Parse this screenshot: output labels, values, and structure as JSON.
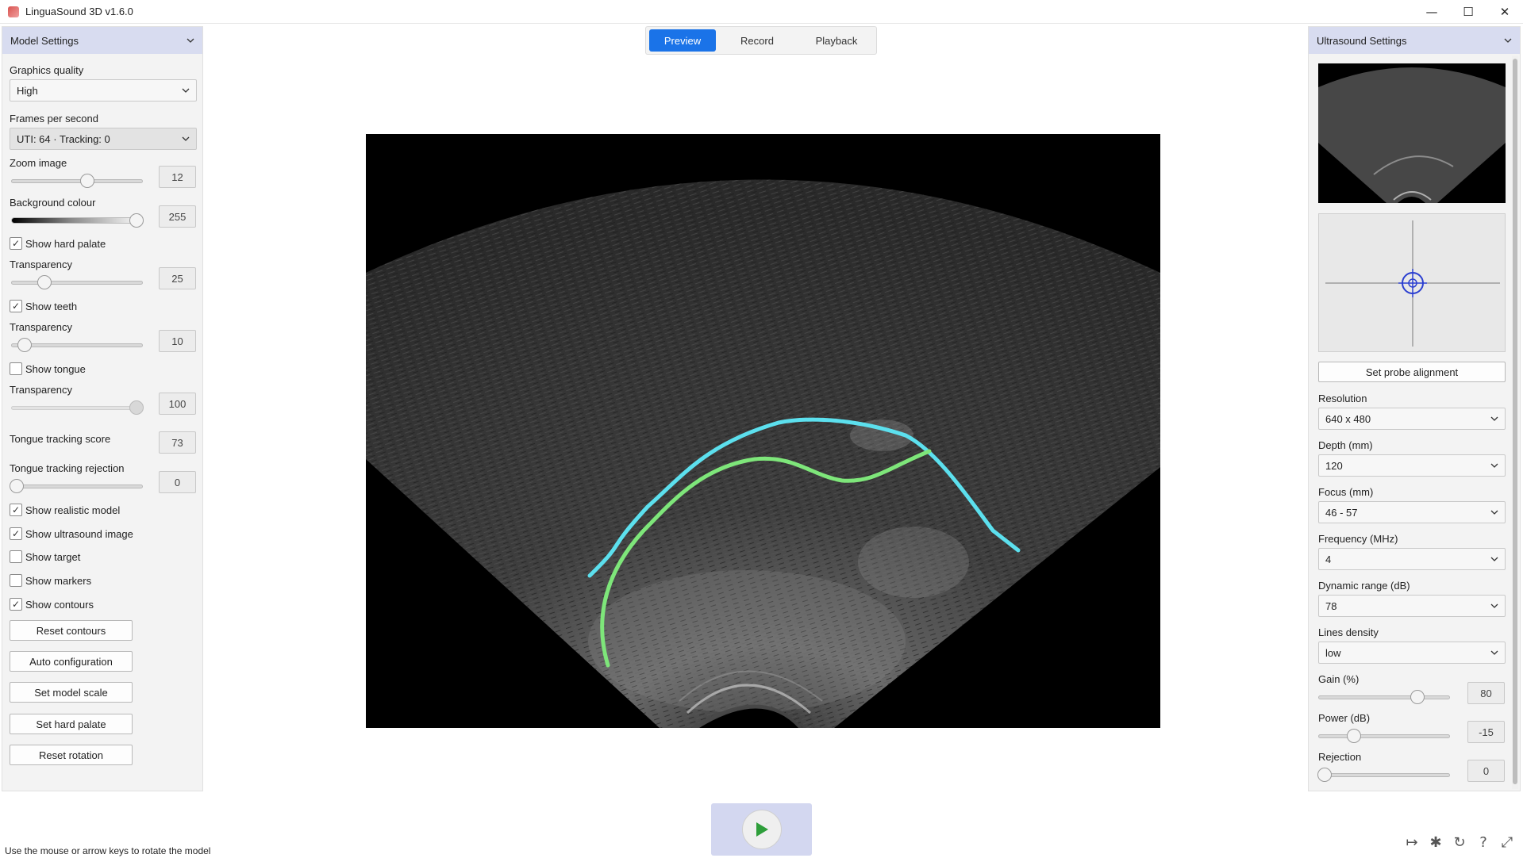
{
  "window": {
    "title": "LinguaSound 3D v1.6.0",
    "minimize_icon": "minimize-icon",
    "maximize_icon": "maximize-icon",
    "close_icon": "close-icon"
  },
  "tabs": [
    {
      "label": "Preview",
      "active": true
    },
    {
      "label": "Record",
      "active": false
    },
    {
      "label": "Playback",
      "active": false
    }
  ],
  "model_settings": {
    "title": "Model Settings",
    "graphics_quality": {
      "label": "Graphics quality",
      "value": "High"
    },
    "fps": {
      "label": "Frames per second",
      "value": "UTI: 64 · Tracking: 0"
    },
    "zoom": {
      "label": "Zoom image",
      "value": "12"
    },
    "background": {
      "label": "Background colour",
      "value": "255"
    },
    "hard_palate": {
      "label": "Show hard palate",
      "checked": true
    },
    "palate_transparency": {
      "label": "Transparency",
      "value": "25"
    },
    "teeth": {
      "label": "Show teeth",
      "checked": true
    },
    "teeth_transparency": {
      "label": "Transparency",
      "value": "10"
    },
    "tongue": {
      "label": "Show tongue",
      "checked": false
    },
    "tongue_transparency": {
      "label": "Transparency",
      "value": "100"
    },
    "tracking_score": {
      "label": "Tongue tracking score",
      "value": "73"
    },
    "tracking_rejection": {
      "label": "Tongue tracking rejection",
      "value": "0"
    },
    "realistic_model": {
      "label": "Show realistic model",
      "checked": true
    },
    "ultrasound_image": {
      "label": "Show ultrasound image",
      "checked": true
    },
    "target": {
      "label": "Show target",
      "checked": false
    },
    "markers": {
      "label": "Show markers",
      "checked": false
    },
    "contours": {
      "label": "Show contours",
      "checked": true
    },
    "buttons": {
      "reset_contours": "Reset contours",
      "auto_config": "Auto configuration",
      "set_model_scale": "Set model scale",
      "set_hard_palate": "Set hard palate",
      "reset_rotation": "Reset rotation"
    }
  },
  "ultrasound_settings": {
    "title": "Ultrasound Settings",
    "set_probe": "Set probe alignment",
    "resolution": {
      "label": "Resolution",
      "value": "640 x 480"
    },
    "depth": {
      "label": "Depth (mm)",
      "value": "120"
    },
    "focus": {
      "label": "Focus (mm)",
      "value": "46 - 57"
    },
    "frequency": {
      "label": "Frequency (MHz)",
      "value": "4"
    },
    "dynamic_range": {
      "label": "Dynamic range (dB)",
      "value": "78"
    },
    "lines_density": {
      "label": "Lines density",
      "value": "low"
    },
    "gain": {
      "label": "Gain (%)",
      "value": "80"
    },
    "power": {
      "label": "Power (dB)",
      "value": "-15"
    },
    "rejection": {
      "label": "Rejection",
      "value": "0"
    }
  },
  "contour_colors": {
    "upper": "#5ce0ee",
    "lower": "#7ee67a"
  },
  "status_text": "Use the mouse or arrow keys to rotate the model",
  "toolbar_icons": [
    "exit-icon",
    "settings-icon",
    "refresh-icon",
    "help-icon",
    "fullscreen-icon"
  ]
}
